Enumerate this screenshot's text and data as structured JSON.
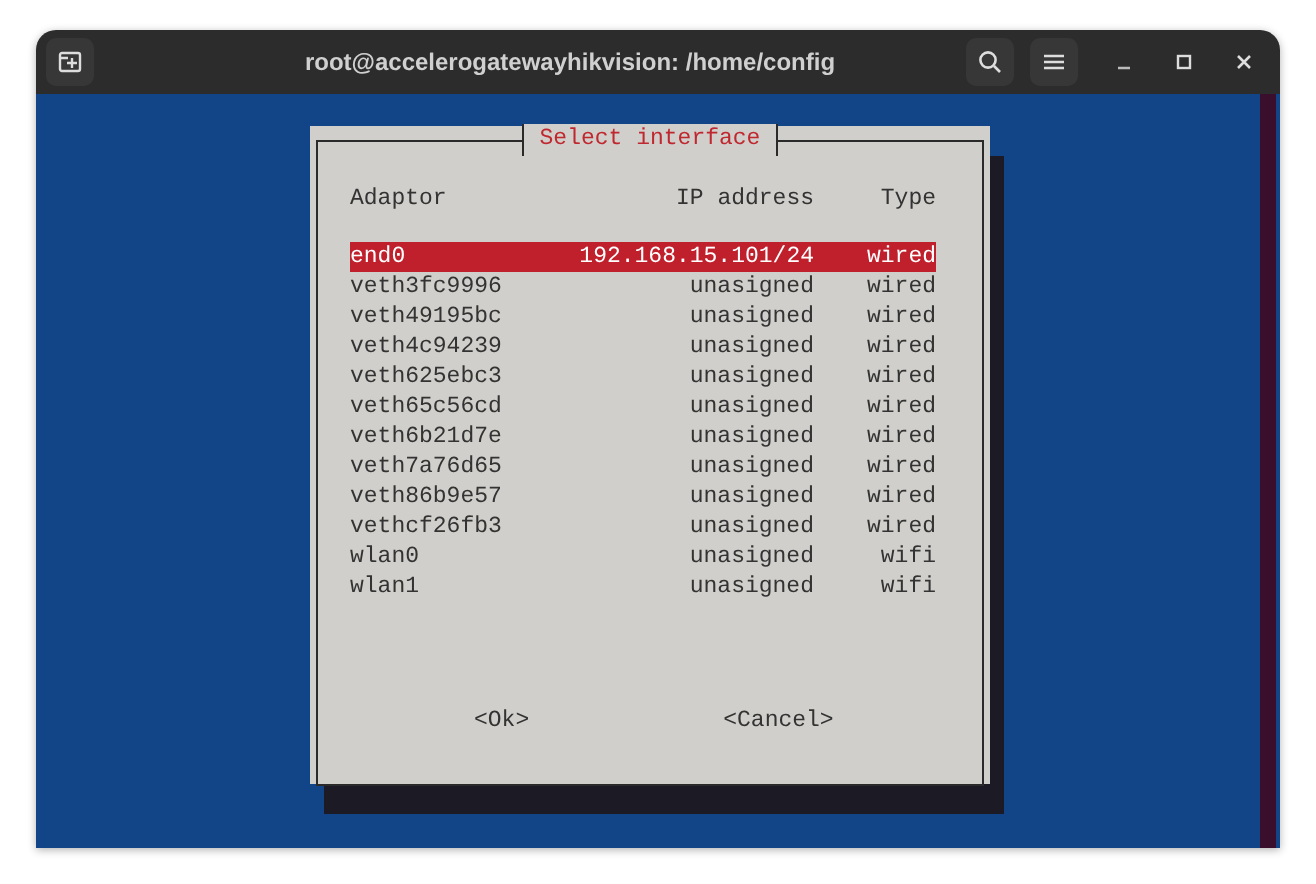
{
  "window": {
    "title": "root@accelerogatewayhikvision: /home/config"
  },
  "dialog": {
    "title": "Select interface",
    "columns": [
      "Adaptor",
      "IP address",
      "Type"
    ],
    "rows": [
      {
        "adaptor": "end0",
        "ip": "192.168.15.101/24",
        "type": "wired",
        "selected": true
      },
      {
        "adaptor": "veth3fc9996",
        "ip": "unasigned",
        "type": "wired",
        "selected": false
      },
      {
        "adaptor": "veth49195bc",
        "ip": "unasigned",
        "type": "wired",
        "selected": false
      },
      {
        "adaptor": "veth4c94239",
        "ip": "unasigned",
        "type": "wired",
        "selected": false
      },
      {
        "adaptor": "veth625ebc3",
        "ip": "unasigned",
        "type": "wired",
        "selected": false
      },
      {
        "adaptor": "veth65c56cd",
        "ip": "unasigned",
        "type": "wired",
        "selected": false
      },
      {
        "adaptor": "veth6b21d7e",
        "ip": "unasigned",
        "type": "wired",
        "selected": false
      },
      {
        "adaptor": "veth7a76d65",
        "ip": "unasigned",
        "type": "wired",
        "selected": false
      },
      {
        "adaptor": "veth86b9e57",
        "ip": "unasigned",
        "type": "wired",
        "selected": false
      },
      {
        "adaptor": "vethcf26fb3",
        "ip": "unasigned",
        "type": "wired",
        "selected": false
      },
      {
        "adaptor": "wlan0",
        "ip": "unasigned",
        "type": "wifi",
        "selected": false
      },
      {
        "adaptor": "wlan1",
        "ip": "unasigned",
        "type": "wifi",
        "selected": false
      }
    ],
    "buttons": [
      "<Ok>",
      "<Cancel>"
    ]
  }
}
